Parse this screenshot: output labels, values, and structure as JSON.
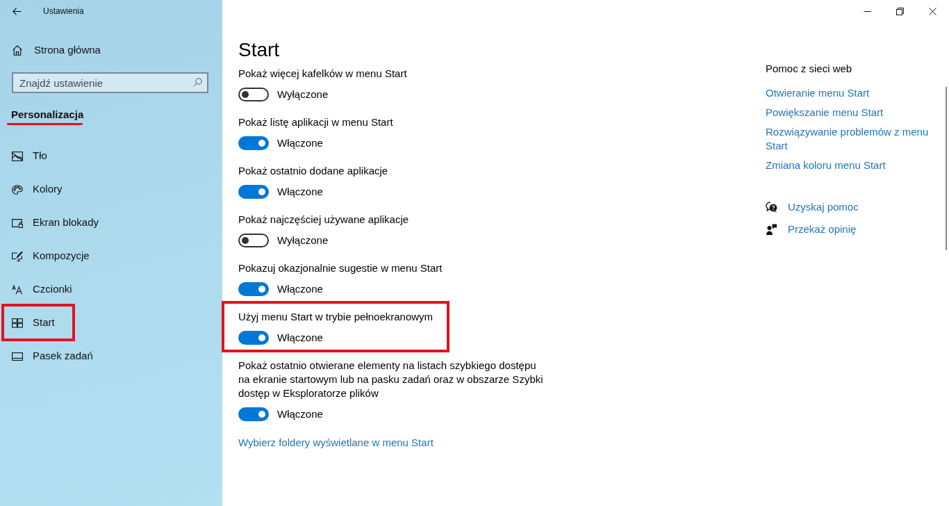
{
  "window": {
    "title": "Ustawienia"
  },
  "sidebar": {
    "home": "Strona główna",
    "search": {
      "placeholder": "Znajdź ustawienie"
    },
    "section": {
      "title": "Personalizacja",
      "underlined": true
    },
    "items": [
      {
        "label": "Tło",
        "highlighted": false
      },
      {
        "label": "Kolory",
        "highlighted": false
      },
      {
        "label": "Ekran blokady",
        "highlighted": false
      },
      {
        "label": "Kompozycje",
        "highlighted": false
      },
      {
        "label": "Czcionki",
        "highlighted": false
      },
      {
        "label": "Start",
        "highlighted": true
      },
      {
        "label": "Pasek zadań",
        "highlighted": false
      }
    ]
  },
  "page": {
    "title": "Start",
    "settings": [
      {
        "label": "Pokaż więcej kafelków w menu Start",
        "on": false,
        "state": "Wyłączone",
        "highlighted": false
      },
      {
        "label": "Pokaż listę aplikacji w menu Start",
        "on": true,
        "state": "Włączone",
        "highlighted": false
      },
      {
        "label": "Pokaż ostatnio dodane aplikacje",
        "on": true,
        "state": "Włączone",
        "highlighted": false
      },
      {
        "label": "Pokaż najczęściej używane aplikacje",
        "on": false,
        "state": "Wyłączone",
        "highlighted": false
      },
      {
        "label": "Pokazuj okazjonalnie sugestie w menu Start",
        "on": true,
        "state": "Włączone",
        "highlighted": false
      },
      {
        "label": "Użyj menu Start w trybie pełnoekranowym",
        "on": true,
        "state": "Włączone",
        "highlighted": true
      },
      {
        "label": "Pokaż ostatnio otwierane elementy na listach szybkiego dostępu na ekranie startowym lub na pasku zadań oraz w obszarze Szybki dostęp w Eksploratorze plików",
        "on": true,
        "state": "Włączone",
        "highlighted": false
      }
    ],
    "link": "Wybierz foldery wyświetlane w menu Start"
  },
  "help": {
    "title": "Pomoc z sieci web",
    "links": [
      "Otwieranie menu Start",
      "Powiększanie menu Start",
      "Rozwiązywanie problemów z menu Start",
      "Zmiana koloru menu Start"
    ],
    "actions": [
      "Uzyskaj pomoc",
      "Przekaż opinię"
    ]
  }
}
